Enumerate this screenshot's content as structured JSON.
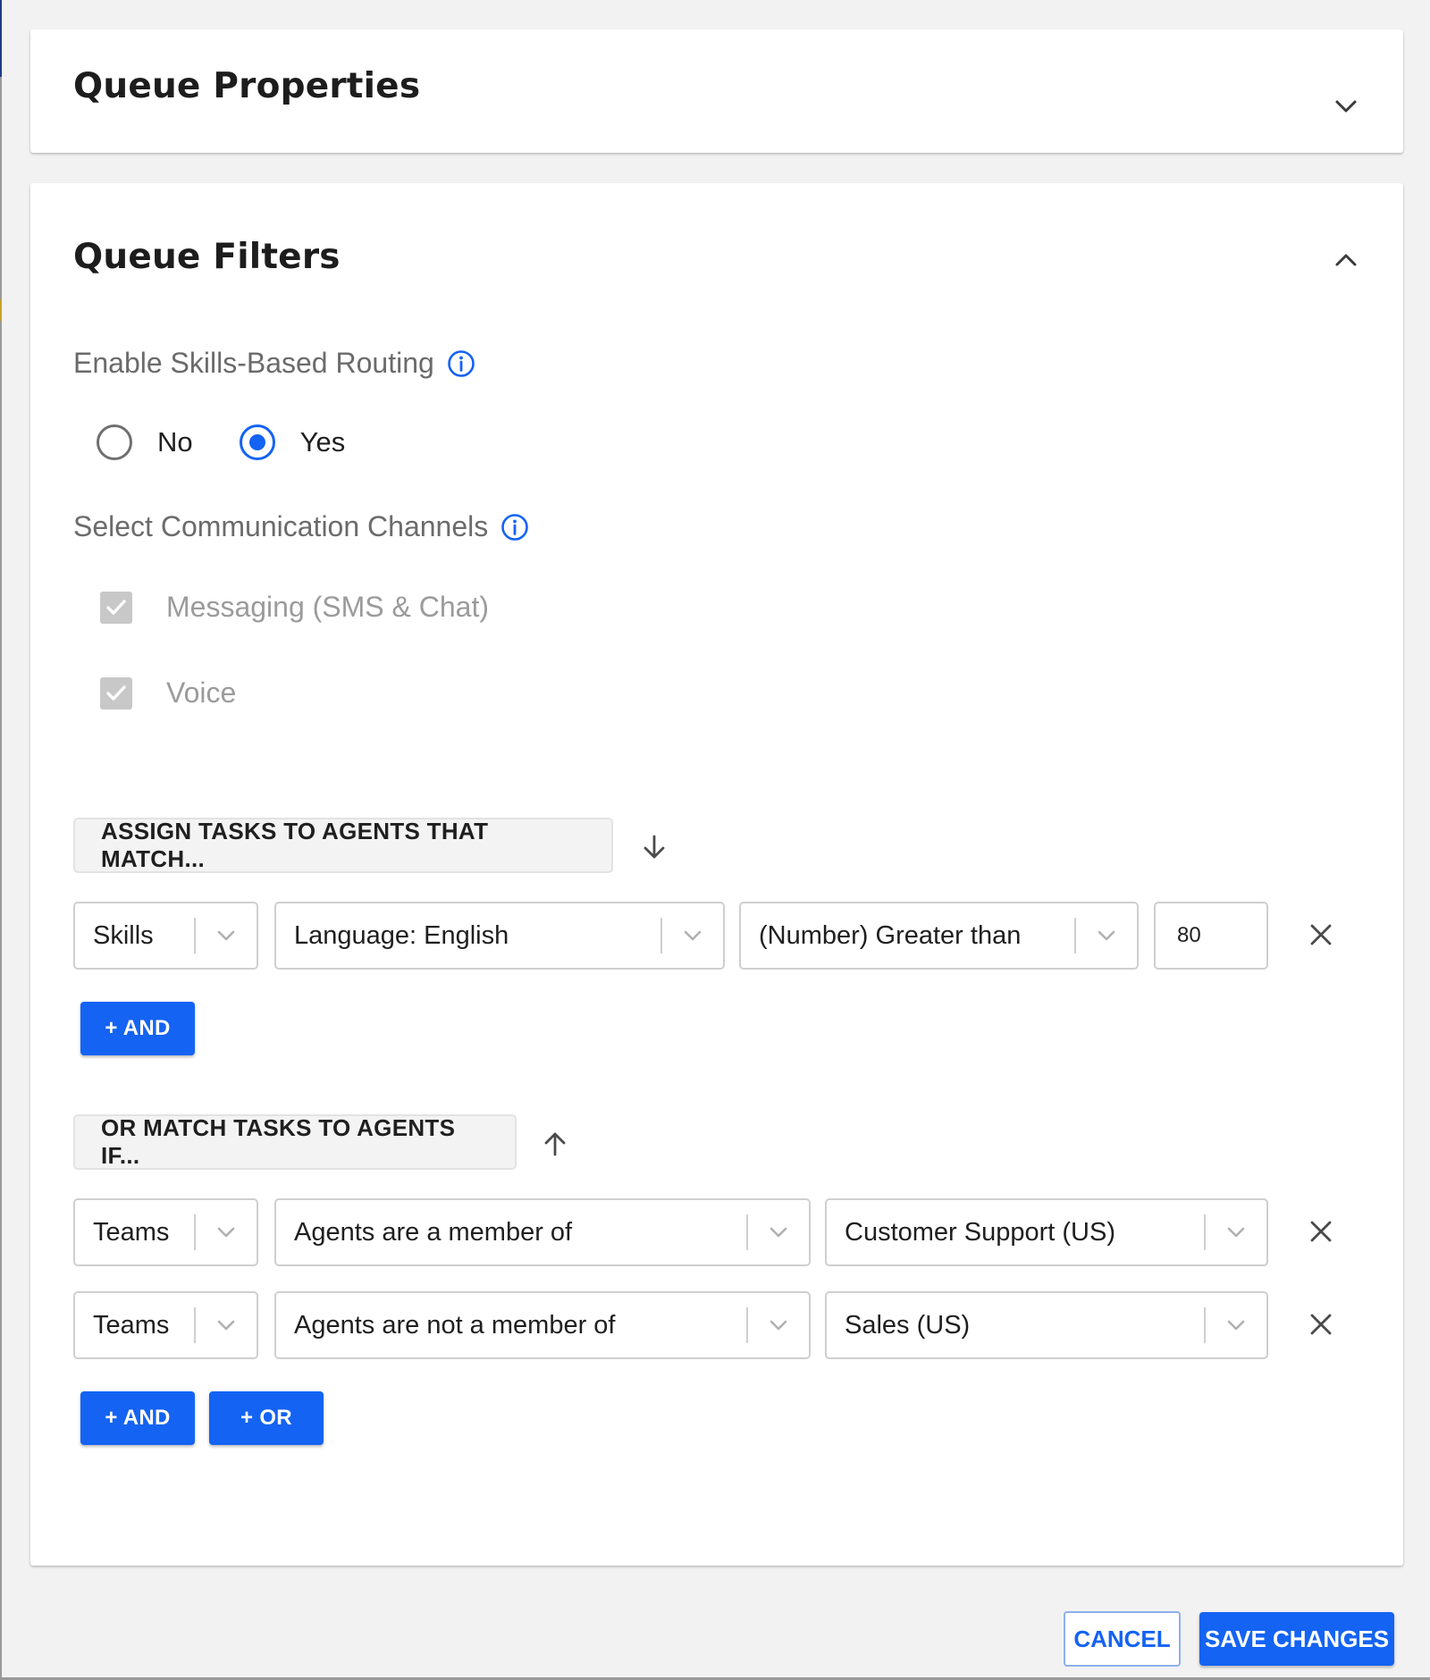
{
  "queue_properties": {
    "title": "Queue Properties",
    "chevron_icon": "chevron-down-icon"
  },
  "queue_filters": {
    "title": "Queue Filters",
    "chevron_icon": "chevron-up-icon",
    "skills_routing": {
      "label": "Enable Skills-Based Routing",
      "options": [
        {
          "label": "No",
          "checked": false
        },
        {
          "label": "Yes",
          "checked": true
        }
      ]
    },
    "channels": {
      "label": "Select Communication Channels",
      "items": [
        {
          "label": "Messaging (SMS & Chat)",
          "checked": true,
          "disabled": true
        },
        {
          "label": "Voice",
          "checked": true,
          "disabled": true
        }
      ]
    },
    "assign_group": {
      "header": "ASSIGN TASKS TO AGENTS THAT MATCH...",
      "arrow_icon": "arrow-down-icon",
      "rule": {
        "field": "Skills",
        "attribute": "Language: English",
        "operator": "(Number) Greater than",
        "value": "80"
      },
      "and_label": "+ AND"
    },
    "or_group": {
      "header": "OR MATCH TASKS TO AGENTS IF...",
      "arrow_icon": "arrow-up-icon",
      "rules": [
        {
          "field": "Teams",
          "operator": "Agents are a member of",
          "value": "Customer Support (US)"
        },
        {
          "field": "Teams",
          "operator": "Agents are not a member of",
          "value": "Sales (US)"
        }
      ],
      "and_label": "+ AND",
      "or_label": "+ OR"
    }
  },
  "footer": {
    "cancel_label": "CANCEL",
    "save_label": "SAVE CHANGES"
  },
  "colors": {
    "accent": "#1463f3",
    "border": "#cfcfcf",
    "muted_text": "#6b6b6b"
  }
}
